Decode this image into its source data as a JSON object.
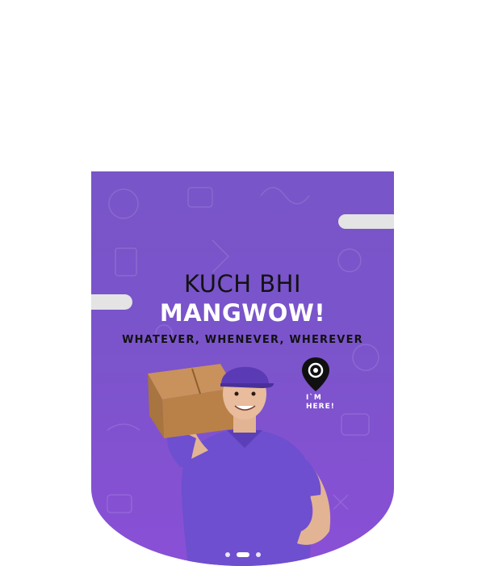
{
  "banner": {
    "headline": "KUCH BHI",
    "brand": "MANGWOW!",
    "tagline": "WHATEVER, WHENEVER, WHEREVER",
    "location_badge_line1": "I`M",
    "location_badge_line2": "HERE!",
    "location_icon": "map-pin-icon",
    "background_color": "#7b54cb",
    "slides": 3,
    "active_slide": 2
  }
}
